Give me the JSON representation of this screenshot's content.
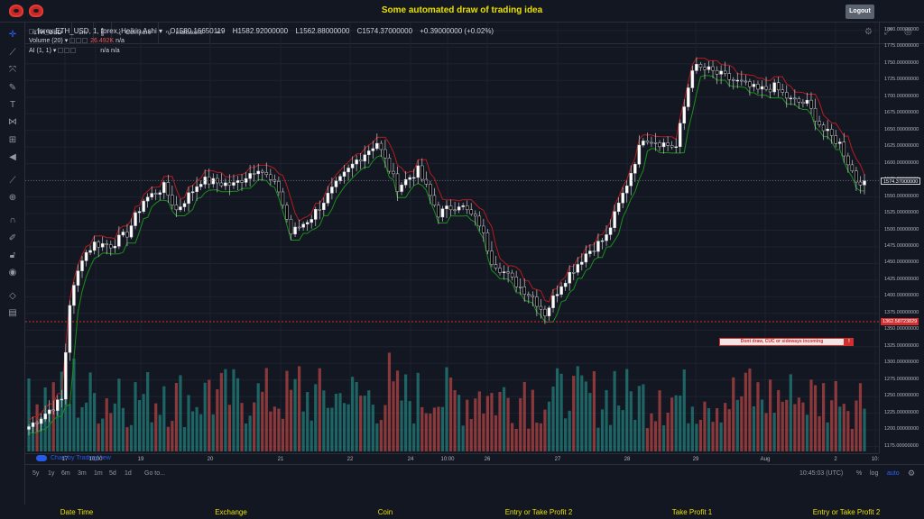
{
  "app": {
    "title": "Some automated draw of trading idea",
    "logout_label": "Logout"
  },
  "toolbar": {
    "symbol": "ETH_USD",
    "interval": "1m",
    "compare_label": "Compare",
    "indicators_label": "Indicators"
  },
  "legend": {
    "main": "forex:ETH_USD, 1, forex, Heikin Ashi",
    "open": "O1580.16650119",
    "high": "H1582.92000000",
    "low": "L1562.88000000",
    "close": "C1574.37000000",
    "change": "+0.39000000 (+0.02%)",
    "volume_label": "Volume (20)",
    "volume_value": "26.492K",
    "volume_na": "n/a",
    "ai_label": "AI (1, 1)",
    "ai_na1": "n/a",
    "ai_na2": "n/a"
  },
  "price_axis": {
    "ticks": [
      "1800.00000000",
      "1775.00000000",
      "1750.00000000",
      "1725.00000000",
      "1700.00000000",
      "1675.00000000",
      "1650.00000000",
      "1625.00000000",
      "1600.00000000",
      "1575.00000000",
      "1550.00000000",
      "1525.00000000",
      "1500.00000000",
      "1475.00000000",
      "1450.00000000",
      "1425.00000000",
      "1400.00000000",
      "1375.00000000",
      "1350.00000000",
      "1325.00000000",
      "1300.00000000",
      "1275.00000000",
      "1250.00000000",
      "1225.00000000",
      "1200.00000000",
      "1175.00000000"
    ],
    "current_price": "1574.37000000",
    "alert_price": "1362.58723829"
  },
  "time_axis": {
    "labels": [
      "17",
      "10:00",
      "19",
      "20",
      "21",
      "22",
      "24",
      "10:00",
      "26",
      "27",
      "28",
      "29",
      "Aug",
      "2",
      "10:"
    ]
  },
  "alert": {
    "text": "Dont draw, CUC or sideways incoming",
    "badge": "!"
  },
  "watermark": "Chart by TradingView",
  "bottombar": {
    "ranges": [
      "5y",
      "1y",
      "6m",
      "3m",
      "1m",
      "5d",
      "1d"
    ],
    "goto": "Go to...",
    "clock": "10:45:03 (UTC)",
    "percent": "%",
    "log": "log",
    "auto": "auto"
  },
  "footer": [
    "Date Time",
    "Exchange",
    "Coin",
    "Entry or Take Profit 2",
    "Take Profit 1",
    "Entry or Take Profit 2"
  ],
  "colors": {
    "background": "#131722",
    "up_candle": "#ffffff",
    "down_candle": "#000000",
    "volume_up": "#26a69a",
    "volume_down": "#ef5350",
    "upper_band": "#b71c1c",
    "lower_band": "#1b8f1b",
    "alert": "#d32f2f",
    "accent_text": "#e8e000"
  },
  "chart_data": {
    "type": "candlestick",
    "series_style": "Heikin Ashi",
    "symbol": "forex:ETH_USD",
    "interval": "1",
    "ylim": [
      1165,
      1812
    ],
    "x_labels": [
      "17",
      "10:00",
      "19",
      "20",
      "21",
      "22",
      "24",
      "10:00",
      "26",
      "27",
      "28",
      "29",
      "Aug",
      "2",
      "10:"
    ],
    "close_path": [
      {
        "t": 0,
        "close": 1205
      },
      {
        "t": 5,
        "close": 1230
      },
      {
        "t": 8,
        "close": 1245
      },
      {
        "t": 10,
        "close": 1390
      },
      {
        "t": 13,
        "close": 1460
      },
      {
        "t": 16,
        "close": 1480
      },
      {
        "t": 20,
        "close": 1478
      },
      {
        "t": 24,
        "close": 1495
      },
      {
        "t": 28,
        "close": 1545
      },
      {
        "t": 33,
        "close": 1565
      },
      {
        "t": 36,
        "close": 1530
      },
      {
        "t": 42,
        "close": 1575
      },
      {
        "t": 50,
        "close": 1568
      },
      {
        "t": 56,
        "close": 1595
      },
      {
        "t": 61,
        "close": 1560
      },
      {
        "t": 64,
        "close": 1495
      },
      {
        "t": 69,
        "close": 1520
      },
      {
        "t": 74,
        "close": 1560
      },
      {
        "t": 80,
        "close": 1605
      },
      {
        "t": 85,
        "close": 1632
      },
      {
        "t": 90,
        "close": 1565
      },
      {
        "t": 95,
        "close": 1590
      },
      {
        "t": 100,
        "close": 1525
      },
      {
        "t": 105,
        "close": 1540
      },
      {
        "t": 110,
        "close": 1510
      },
      {
        "t": 113,
        "close": 1455
      },
      {
        "t": 118,
        "close": 1425
      },
      {
        "t": 123,
        "close": 1400
      },
      {
        "t": 126,
        "close": 1375
      },
      {
        "t": 130,
        "close": 1420
      },
      {
        "t": 136,
        "close": 1465
      },
      {
        "t": 141,
        "close": 1490
      },
      {
        "t": 146,
        "close": 1570
      },
      {
        "t": 150,
        "close": 1640
      },
      {
        "t": 155,
        "close": 1630
      },
      {
        "t": 158,
        "close": 1625
      },
      {
        "t": 162,
        "close": 1745
      },
      {
        "t": 166,
        "close": 1740
      },
      {
        "t": 170,
        "close": 1730
      },
      {
        "t": 174,
        "close": 1720
      },
      {
        "t": 178,
        "close": 1710
      },
      {
        "t": 182,
        "close": 1715
      },
      {
        "t": 186,
        "close": 1695
      },
      {
        "t": 190,
        "close": 1690
      },
      {
        "t": 194,
        "close": 1650
      },
      {
        "t": 198,
        "close": 1630
      },
      {
        "t": 202,
        "close": 1575
      },
      {
        "t": 204,
        "close": 1574.37
      }
    ],
    "current_price": 1574.37,
    "alert_level": 1362.58723829,
    "indicators": [
      {
        "name": "Volume (20)",
        "value": 26492
      },
      {
        "name": "AI (1, 1)"
      }
    ]
  }
}
